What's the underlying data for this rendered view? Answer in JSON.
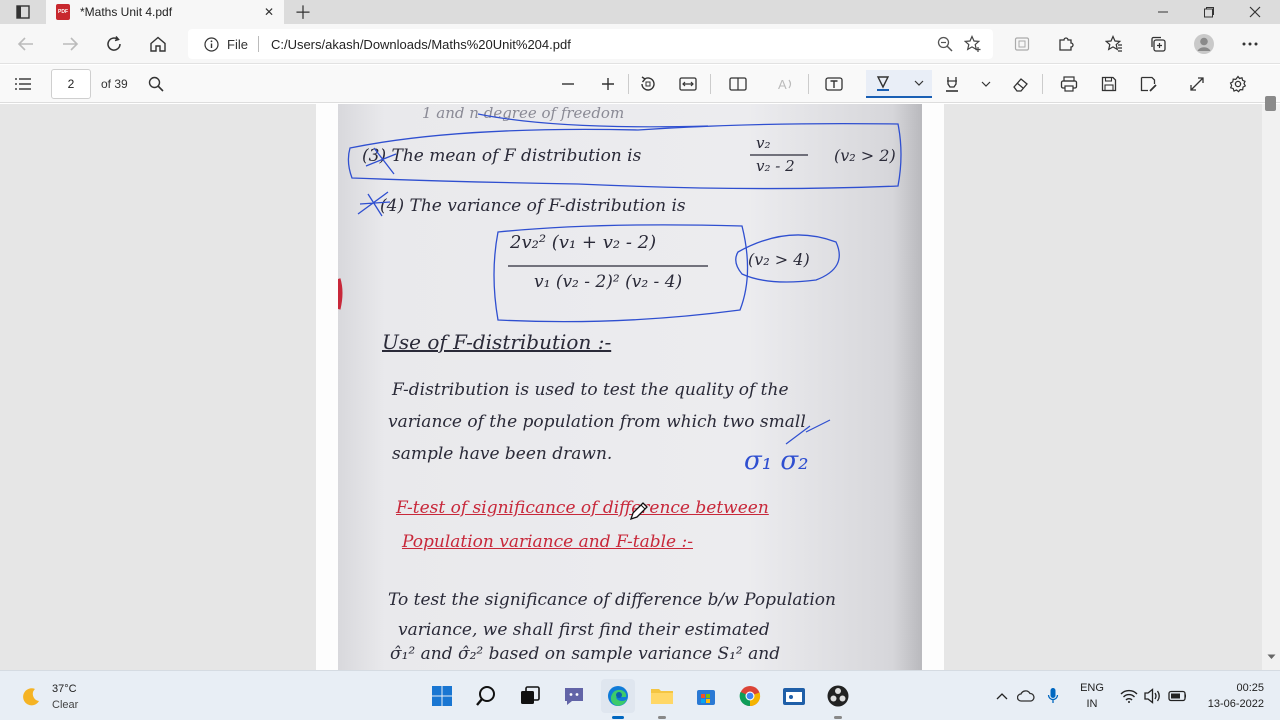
{
  "browser": {
    "tab": {
      "title": "*Maths Unit 4.pdf",
      "badge": "PDF"
    },
    "address": {
      "site_label": "File",
      "url": "C:/Users/akash/Downloads/Maths%20Unit%204.pdf"
    }
  },
  "pdf_toolbar": {
    "page_number": "2",
    "page_count": "of 39"
  },
  "document": {
    "line1": "1 and n degree of freedom",
    "line2": "(3) The mean of F distribution is",
    "mean_num": "v₂",
    "mean_den": "v₂ - 2",
    "mean_cond": "(v₂ > 2)",
    "line3": "(4) The variance of F-distribution is",
    "var_num": "2v₂² (v₁ + v₂ - 2)",
    "var_den": "v₁ (v₂ - 2)² (v₂ - 4)",
    "var_cond": "(v₂ > 4)",
    "heading1": "Use of F-distribution :-",
    "para1_1": "F-distribution is used to test the quality of the",
    "para1_2": "variance of the population from which two small",
    "para1_3": "sample have been drawn.",
    "sigma_note": "σ₁   σ₂",
    "heading2_1": "F-test of significance of difference between",
    "heading2_2": "Population variance and F-table :-",
    "para2_1": "To test the significance of difference b/w Population",
    "para2_2": "variance, we shall first find their estimated",
    "para2_3": "σ̂₁² and σ̂₂² based on sample variance S₁² and"
  },
  "taskbar": {
    "weather_temp": "37°C",
    "weather_desc": "Clear",
    "lang_1": "ENG",
    "lang_2": "IN",
    "time": "00:25",
    "date": "13-06-2022"
  },
  "colors": {
    "ink": "#2a2a38",
    "red_ink": "#c8283a",
    "blue_pen": "#2f4fd0",
    "taskbar": "#e8eef5"
  }
}
